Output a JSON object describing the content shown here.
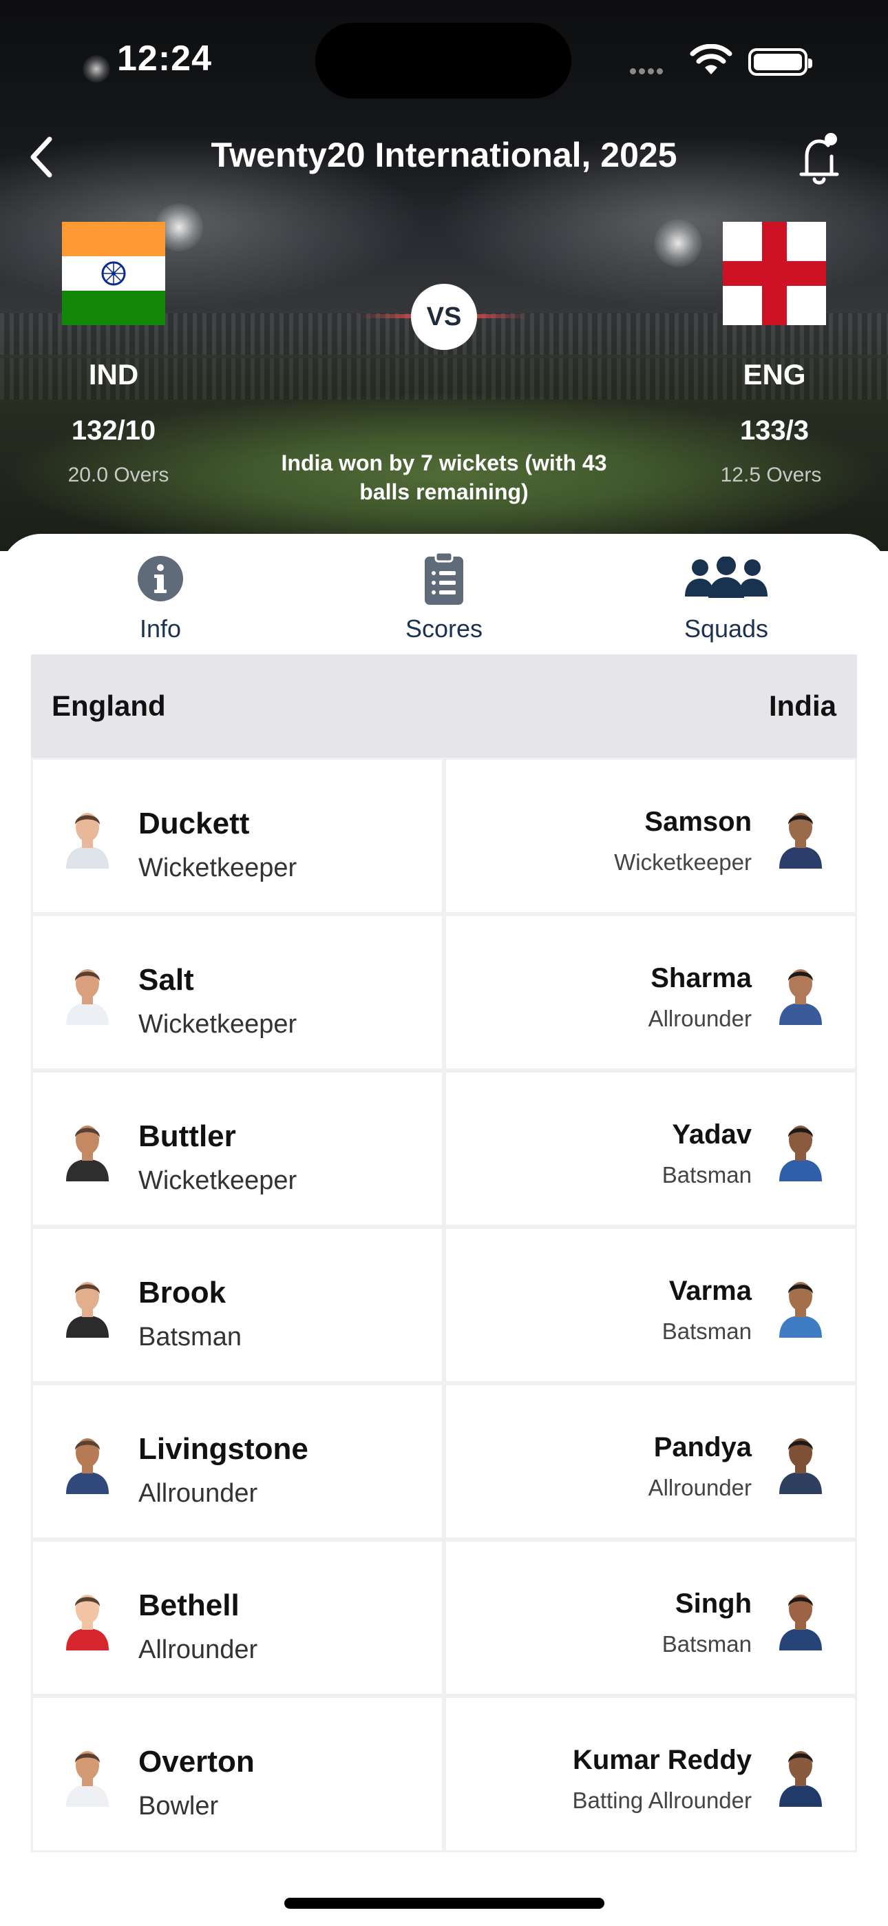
{
  "status_bar": {
    "time": "12:24"
  },
  "header": {
    "title": "Twenty20 International, 2025"
  },
  "match": {
    "vs_label": "VS",
    "team_left": {
      "code": "IND",
      "score": "132/10",
      "overs": "20.0 Overs"
    },
    "team_right": {
      "code": "ENG",
      "score": "133/3",
      "overs": "12.5 Overs"
    },
    "result_line1": "India won by 7 wickets (with 43",
    "result_line2": "balls remaining)"
  },
  "tabs": [
    {
      "label": "Info",
      "icon": "info-icon",
      "active": false
    },
    {
      "label": "Scores",
      "icon": "clipboard-icon",
      "active": false
    },
    {
      "label": "Squads",
      "icon": "group-icon",
      "active": true
    }
  ],
  "squads": {
    "left_team": "England",
    "right_team": "India",
    "rows": [
      {
        "left": {
          "name": "Duckett",
          "role": "Wicketkeeper"
        },
        "right": {
          "name": "Samson",
          "role": "Wicketkeeper"
        }
      },
      {
        "left": {
          "name": "Salt",
          "role": "Wicketkeeper"
        },
        "right": {
          "name": "Sharma",
          "role": "Allrounder"
        }
      },
      {
        "left": {
          "name": "Buttler",
          "role": "Wicketkeeper"
        },
        "right": {
          "name": "Yadav",
          "role": "Batsman"
        }
      },
      {
        "left": {
          "name": "Brook",
          "role": "Batsman"
        },
        "right": {
          "name": "Varma",
          "role": "Batsman"
        }
      },
      {
        "left": {
          "name": "Livingstone",
          "role": "Allrounder"
        },
        "right": {
          "name": "Pandya",
          "role": "Allrounder"
        }
      },
      {
        "left": {
          "name": "Bethell",
          "role": "Allrounder"
        },
        "right": {
          "name": "Singh",
          "role": "Batsman"
        }
      },
      {
        "left": {
          "name": "Overton",
          "role": "Bowler"
        },
        "right": {
          "name": "Kumar Reddy",
          "role": "Batting Allrounder"
        }
      }
    ]
  },
  "colors": {
    "tab_label": "#1b3350",
    "icon_gray": "#5f6b79",
    "squads_icon": "#18324f",
    "header_bg": "#e5e5ea"
  }
}
